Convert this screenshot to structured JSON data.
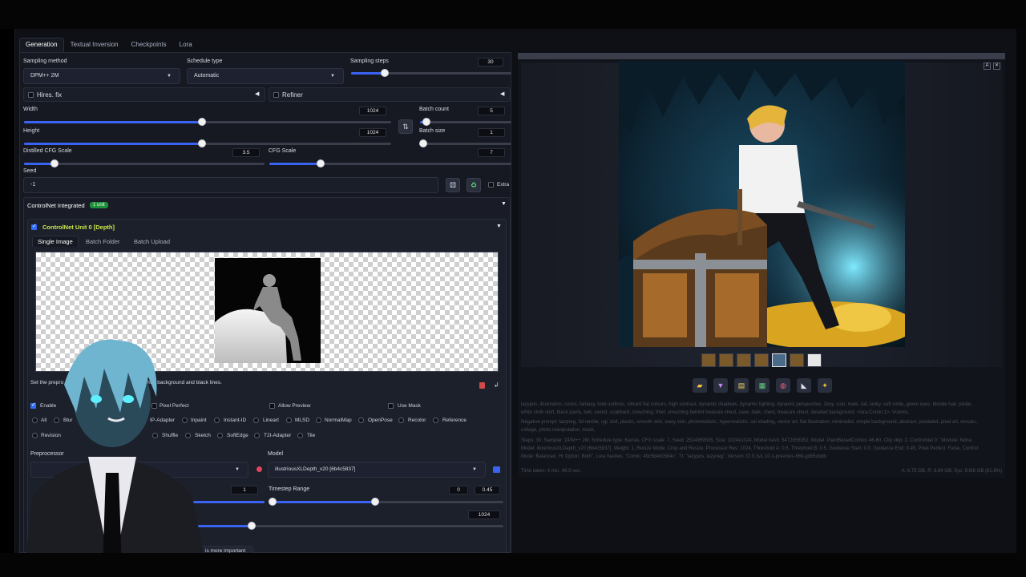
{
  "tabs": [
    "Generation",
    "Textual Inversion",
    "Checkpoints",
    "Lora"
  ],
  "sampling": {
    "method_label": "Sampling method",
    "method": "DPM++ 2M",
    "schedule_label": "Schedule type",
    "schedule": "Automatic",
    "steps_label": "Sampling steps",
    "steps": "30",
    "steps_fraction": 0.15
  },
  "accordions": {
    "hires": "Hires. fix",
    "refiner": "Refiner"
  },
  "size": {
    "width_label": "Width",
    "width": "1024",
    "height_label": "Height",
    "height": "1024",
    "batch_count_label": "Batch count",
    "batch_count": "5",
    "batch_size_label": "Batch size",
    "batch_size": "1",
    "swap_icon": "swap-arrows-icon"
  },
  "cfg": {
    "distilled_label": "Distilled CFG Scale",
    "distilled": "3.5",
    "cfg_label": "CFG Scale",
    "cfg": "7"
  },
  "seed": {
    "label": "Seed",
    "value": "-1",
    "extra_label": "Extra"
  },
  "controlnet": {
    "title": "ControlNet Integrated",
    "badge": "1 unit",
    "unit_title": "ControlNet Unit 0 [Depth]",
    "subtabs": [
      "Single Image",
      "Batch Folder",
      "Batch Upload"
    ],
    "note": "Set the preprocessor to [invert] if your image has white background and black lines.",
    "note_visible_start": "Set the prepro",
    "note_visible_end": "hite background and black lines.",
    "enable": "Enable",
    "pixel_perfect": "Pixel Perfect",
    "allow_preview": "Allow Preview",
    "use_mask": "Use Mask",
    "types_row1": [
      "All",
      "Blur",
      "IP-Adapter",
      "Inpaint",
      "Instant-ID",
      "Lineart",
      "MLSD",
      "NormalMap",
      "OpenPose",
      "Recolor",
      "Reference"
    ],
    "types_row2": [
      "Revision",
      "Shuffle",
      "Sketch",
      "SoftEdge",
      "T2I-Adapter",
      "Tile"
    ],
    "preprocessor_label": "Preprocessor",
    "model_label": "Model",
    "model_value": "illustriousXLDepth_v20 [6b4c5837]",
    "weight": "1",
    "timestep_label": "Timestep Range",
    "timestep_start": "0",
    "timestep_end": "0.45",
    "resolution": "1024",
    "control_mode_partial": "is more important"
  },
  "output": {
    "prompt_text": "lazypos, illustration, comic, fantasy, bold outlines, vibrant flat colours, high contrast, dynamic shadows, dynamic lighting, dynamic perspective, 1boy, solo, male, tall, lanky, soft smile, green eyes, blonde hair, pirate, white cloth shirt, black pants, belt, sword, scabbard, crouching, thief, crouching behind treasure chest, cave, dark, chest, treasure chest, detailed background, <lora:Comic:1>, Vcomic,",
    "negative_text": "Negative prompt: lazyneg, 3d render, cgi, doll, plastic, smooth skin, waxy skin, photorealistic, hyperrealistic, cel shading, vector art, flat illustration, minimalist, simple background, abstract, pixelated, pixel art, mosaic, collage, photo manipulation, mask,",
    "params_text": "Steps: 30, Sampler: DPM++ 2M, Schedule type: Karras, CFG scale: 7, Seed: 2524959505, Size: 1024x1024, Model hash: 5472b56352, Model: PlantBasedComics 46-60, Clip skip: 2, ControlNet 0: \"Module: None, Model: illustriousXLDepth_v20 [6b4c5837], Weight: 1, Resize Mode: Crop and Resize, Processor Res: 1024, Threshold A: 0.5, Threshold B: 0.5, Guidance Start: 0.0, Guidance End: 0.45, Pixel Perfect: False, Control Mode: Balanced, Hr Option: Both\", Lora hashes: \"Comic: 49c5b4b0584c\", TI: \"lazypos, lazyneg\", Version: f2.0.1v1.10.1-previous-669-gdb5cbdb",
    "time_text": "Time taken: 4 min. 48.9 sec.",
    "mem_text": "A: 6.75 GB, R: 8.84 GB, Sys: 9.8/8 GB (81.8%)"
  },
  "colors": {
    "accent": "#3b63f2",
    "badge": "#1e8f3a",
    "unit_title": "#cde84b"
  }
}
